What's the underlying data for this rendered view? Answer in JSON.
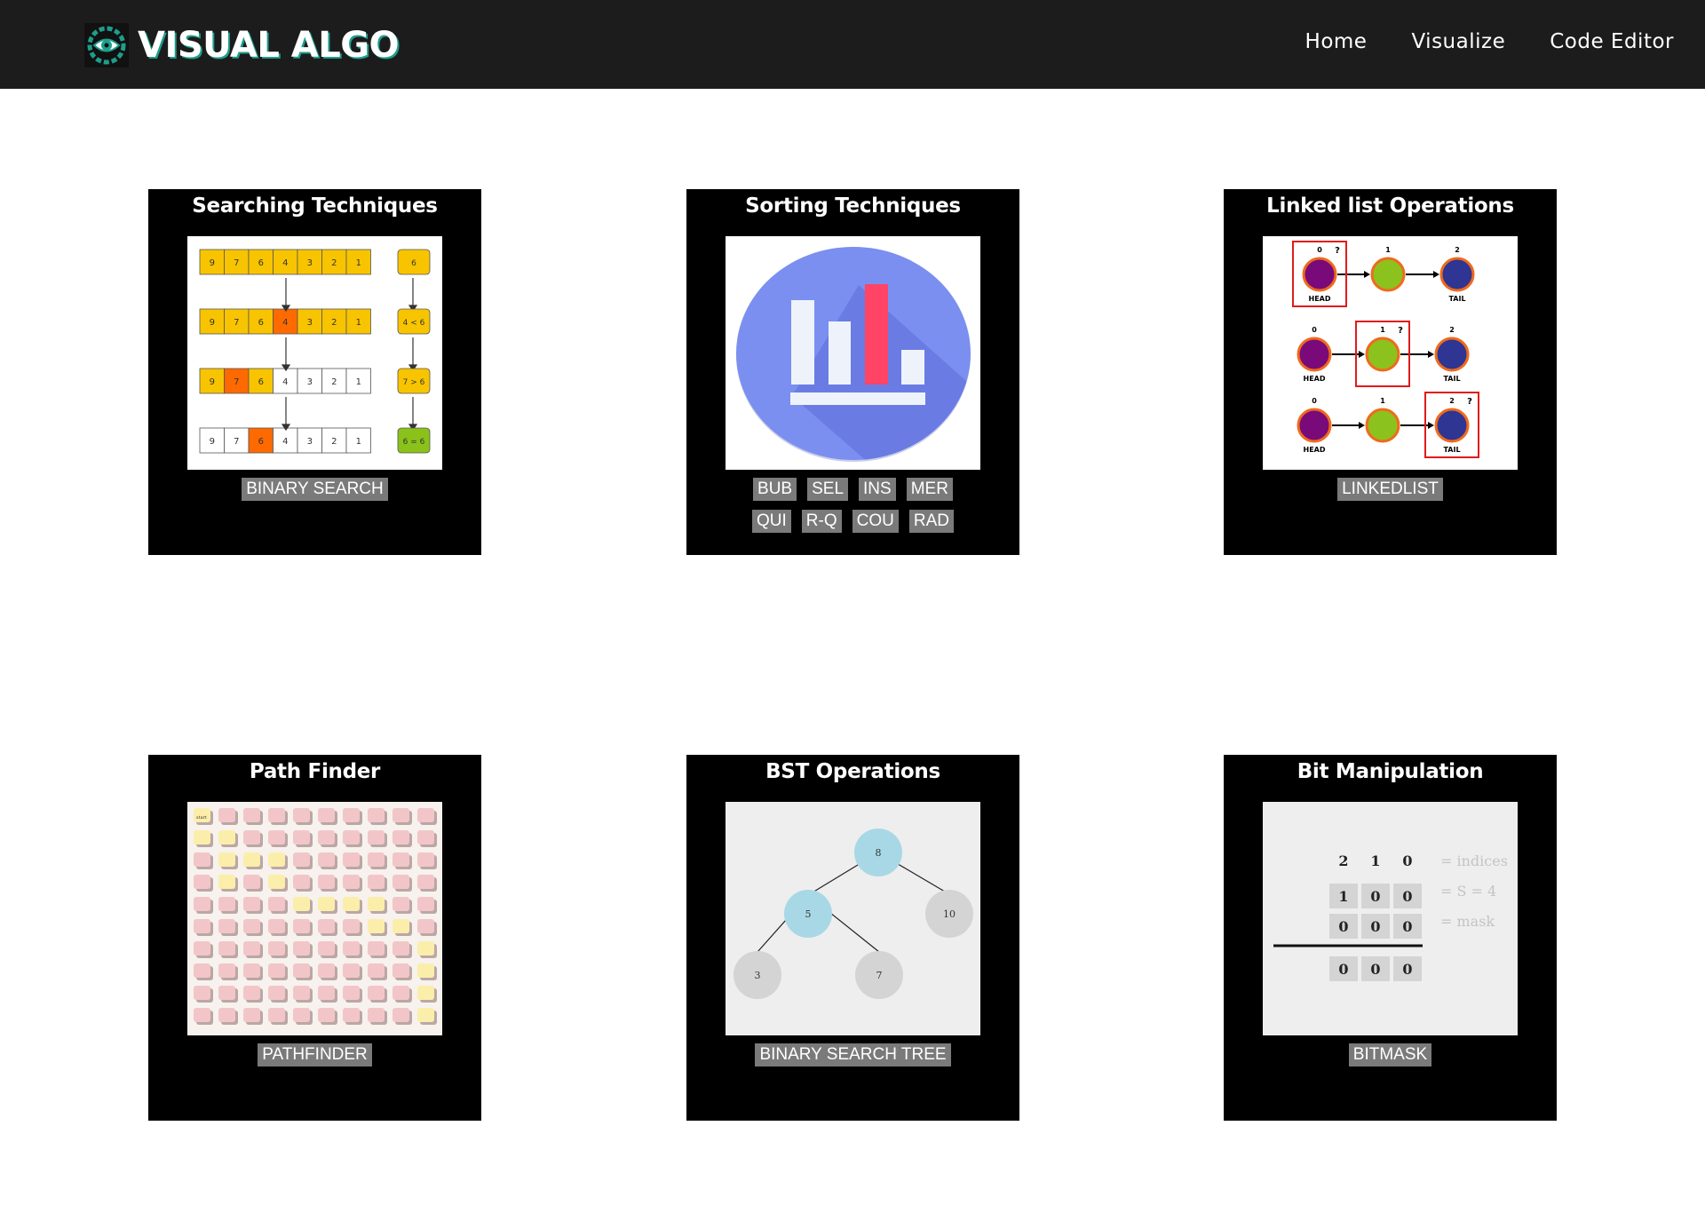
{
  "brand": {
    "name": "VISUAL ALGO",
    "logo_icon": "eye-gear-icon"
  },
  "nav": {
    "items": [
      "Home",
      "Visualize",
      "Code Editor"
    ]
  },
  "cards": {
    "searching": {
      "title": "Searching Techniques",
      "buttons": [
        "BINARY SEARCH"
      ],
      "thumb": {
        "rows": [
          [
            "9",
            "7",
            "6",
            "4",
            "3",
            "2",
            "1"
          ],
          [
            "9",
            "7",
            "6",
            "4",
            "3",
            "2",
            "1"
          ],
          [
            "9",
            "7",
            "6",
            "4",
            "3",
            "2",
            "1"
          ],
          [
            "9",
            "7",
            "6",
            "4",
            "3",
            "2",
            "1"
          ]
        ],
        "compare": [
          "6",
          "4 < 6",
          "7 > 6",
          "6 = 6"
        ]
      }
    },
    "sorting": {
      "title": "Sorting Techniques",
      "buttons": [
        "BUB",
        "SEL",
        "INS",
        "MER",
        "QUI",
        "R-Q",
        "COU",
        "RAD"
      ],
      "icon": "bar-chart-icon"
    },
    "linkedlist": {
      "title": "Linked list Operations",
      "buttons": [
        "LINKEDLIST"
      ],
      "thumb": {
        "indices": [
          "0",
          "1",
          "2"
        ],
        "head": "HEAD",
        "tail": "TAIL",
        "marker": "?"
      }
    },
    "pathfinder": {
      "title": "Path Finder",
      "buttons": [
        "PATHFINDER"
      ],
      "thumb": {
        "start": "start"
      }
    },
    "bst": {
      "title": "BST Operations",
      "buttons": [
        "BINARY SEARCH TREE"
      ],
      "thumb": {
        "nodes": [
          "8",
          "5",
          "10",
          "3",
          "7"
        ]
      }
    },
    "bit": {
      "title": "Bit Manipulation",
      "buttons": [
        "BITMASK"
      ],
      "thumb": {
        "indices": [
          "2",
          "1",
          "0"
        ],
        "s_bits": [
          "1",
          "0",
          "0"
        ],
        "mask_bits": [
          "0",
          "0",
          "0"
        ],
        "result_bits": [
          "0",
          "0",
          "0"
        ],
        "labels": [
          "= indices",
          "= S = 4",
          "= mask"
        ]
      }
    }
  },
  "colors": {
    "nav_bg": "#1c1c1c",
    "accent": "#1e9e8c",
    "card_bg": "#000000",
    "button_bg": "#7a7a7a"
  }
}
